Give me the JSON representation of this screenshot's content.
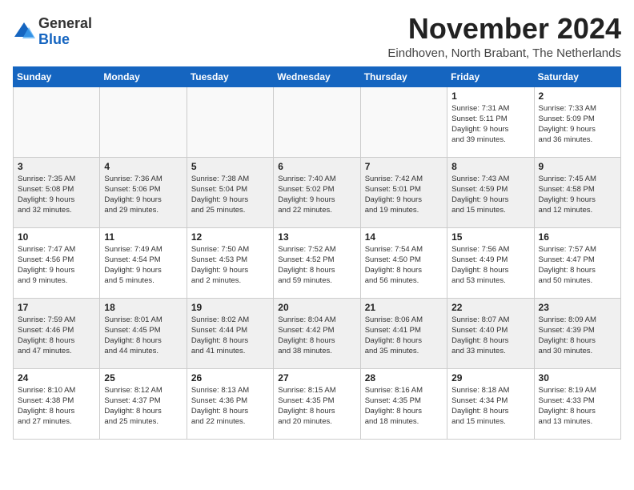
{
  "logo": {
    "general": "General",
    "blue": "Blue"
  },
  "header": {
    "title": "November 2024",
    "location": "Eindhoven, North Brabant, The Netherlands"
  },
  "weekdays": [
    "Sunday",
    "Monday",
    "Tuesday",
    "Wednesday",
    "Thursday",
    "Friday",
    "Saturday"
  ],
  "weeks": [
    [
      {
        "day": "",
        "info": ""
      },
      {
        "day": "",
        "info": ""
      },
      {
        "day": "",
        "info": ""
      },
      {
        "day": "",
        "info": ""
      },
      {
        "day": "",
        "info": ""
      },
      {
        "day": "1",
        "info": "Sunrise: 7:31 AM\nSunset: 5:11 PM\nDaylight: 9 hours\nand 39 minutes."
      },
      {
        "day": "2",
        "info": "Sunrise: 7:33 AM\nSunset: 5:09 PM\nDaylight: 9 hours\nand 36 minutes."
      }
    ],
    [
      {
        "day": "3",
        "info": "Sunrise: 7:35 AM\nSunset: 5:08 PM\nDaylight: 9 hours\nand 32 minutes."
      },
      {
        "day": "4",
        "info": "Sunrise: 7:36 AM\nSunset: 5:06 PM\nDaylight: 9 hours\nand 29 minutes."
      },
      {
        "day": "5",
        "info": "Sunrise: 7:38 AM\nSunset: 5:04 PM\nDaylight: 9 hours\nand 25 minutes."
      },
      {
        "day": "6",
        "info": "Sunrise: 7:40 AM\nSunset: 5:02 PM\nDaylight: 9 hours\nand 22 minutes."
      },
      {
        "day": "7",
        "info": "Sunrise: 7:42 AM\nSunset: 5:01 PM\nDaylight: 9 hours\nand 19 minutes."
      },
      {
        "day": "8",
        "info": "Sunrise: 7:43 AM\nSunset: 4:59 PM\nDaylight: 9 hours\nand 15 minutes."
      },
      {
        "day": "9",
        "info": "Sunrise: 7:45 AM\nSunset: 4:58 PM\nDaylight: 9 hours\nand 12 minutes."
      }
    ],
    [
      {
        "day": "10",
        "info": "Sunrise: 7:47 AM\nSunset: 4:56 PM\nDaylight: 9 hours\nand 9 minutes."
      },
      {
        "day": "11",
        "info": "Sunrise: 7:49 AM\nSunset: 4:54 PM\nDaylight: 9 hours\nand 5 minutes."
      },
      {
        "day": "12",
        "info": "Sunrise: 7:50 AM\nSunset: 4:53 PM\nDaylight: 9 hours\nand 2 minutes."
      },
      {
        "day": "13",
        "info": "Sunrise: 7:52 AM\nSunset: 4:52 PM\nDaylight: 8 hours\nand 59 minutes."
      },
      {
        "day": "14",
        "info": "Sunrise: 7:54 AM\nSunset: 4:50 PM\nDaylight: 8 hours\nand 56 minutes."
      },
      {
        "day": "15",
        "info": "Sunrise: 7:56 AM\nSunset: 4:49 PM\nDaylight: 8 hours\nand 53 minutes."
      },
      {
        "day": "16",
        "info": "Sunrise: 7:57 AM\nSunset: 4:47 PM\nDaylight: 8 hours\nand 50 minutes."
      }
    ],
    [
      {
        "day": "17",
        "info": "Sunrise: 7:59 AM\nSunset: 4:46 PM\nDaylight: 8 hours\nand 47 minutes."
      },
      {
        "day": "18",
        "info": "Sunrise: 8:01 AM\nSunset: 4:45 PM\nDaylight: 8 hours\nand 44 minutes."
      },
      {
        "day": "19",
        "info": "Sunrise: 8:02 AM\nSunset: 4:44 PM\nDaylight: 8 hours\nand 41 minutes."
      },
      {
        "day": "20",
        "info": "Sunrise: 8:04 AM\nSunset: 4:42 PM\nDaylight: 8 hours\nand 38 minutes."
      },
      {
        "day": "21",
        "info": "Sunrise: 8:06 AM\nSunset: 4:41 PM\nDaylight: 8 hours\nand 35 minutes."
      },
      {
        "day": "22",
        "info": "Sunrise: 8:07 AM\nSunset: 4:40 PM\nDaylight: 8 hours\nand 33 minutes."
      },
      {
        "day": "23",
        "info": "Sunrise: 8:09 AM\nSunset: 4:39 PM\nDaylight: 8 hours\nand 30 minutes."
      }
    ],
    [
      {
        "day": "24",
        "info": "Sunrise: 8:10 AM\nSunset: 4:38 PM\nDaylight: 8 hours\nand 27 minutes."
      },
      {
        "day": "25",
        "info": "Sunrise: 8:12 AM\nSunset: 4:37 PM\nDaylight: 8 hours\nand 25 minutes."
      },
      {
        "day": "26",
        "info": "Sunrise: 8:13 AM\nSunset: 4:36 PM\nDaylight: 8 hours\nand 22 minutes."
      },
      {
        "day": "27",
        "info": "Sunrise: 8:15 AM\nSunset: 4:35 PM\nDaylight: 8 hours\nand 20 minutes."
      },
      {
        "day": "28",
        "info": "Sunrise: 8:16 AM\nSunset: 4:35 PM\nDaylight: 8 hours\nand 18 minutes."
      },
      {
        "day": "29",
        "info": "Sunrise: 8:18 AM\nSunset: 4:34 PM\nDaylight: 8 hours\nand 15 minutes."
      },
      {
        "day": "30",
        "info": "Sunrise: 8:19 AM\nSunset: 4:33 PM\nDaylight: 8 hours\nand 13 minutes."
      }
    ]
  ]
}
